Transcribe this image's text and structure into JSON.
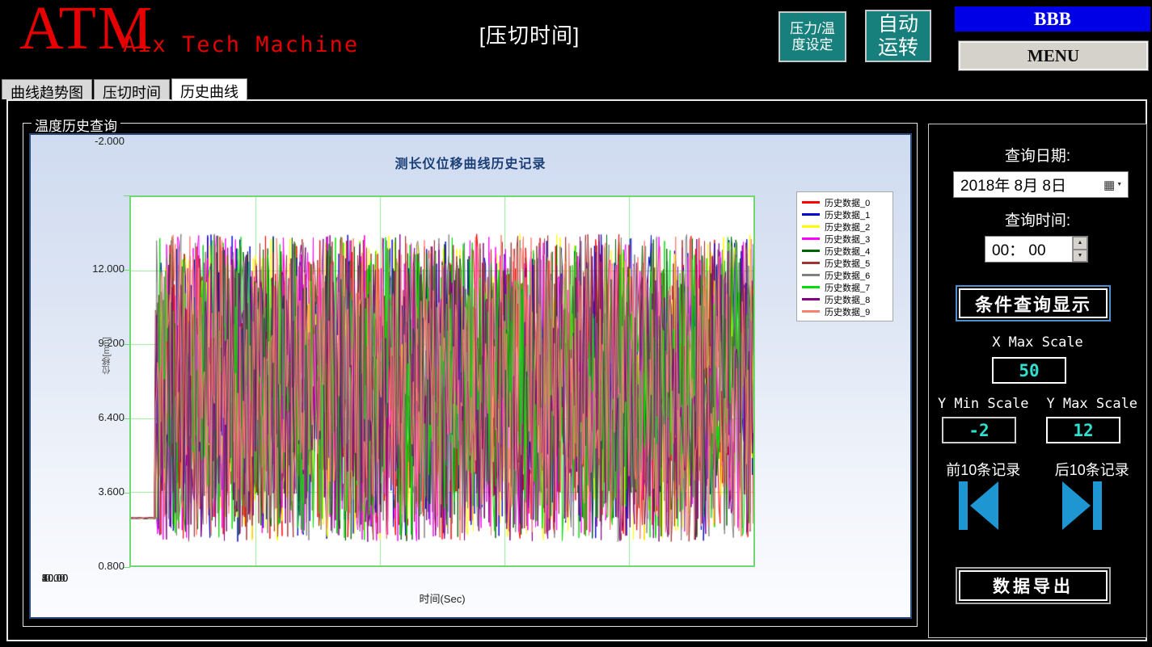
{
  "header": {
    "logo": "ATM",
    "logo_subtitle": "Aix Tech Machine",
    "page_title": "[压切时间]",
    "btn_pressure_temp_line1": "压力/温",
    "btn_pressure_temp_line2": "度设定",
    "btn_auto_line1": "自动",
    "btn_auto_line2": "运转",
    "banner": "BBB",
    "menu": "MENU"
  },
  "tabs": [
    {
      "label": "曲线趋势图",
      "active": false
    },
    {
      "label": "压切时间",
      "active": false
    },
    {
      "label": "历史曲线",
      "active": true
    }
  ],
  "groupbox_title": "温度历史查询",
  "chart_data": {
    "type": "line",
    "title": "测长仪位移曲线历史记录",
    "xlabel": "时间(Sec)",
    "ylabel": "位移[mm]",
    "xlim": [
      0,
      50
    ],
    "ylim": [
      -2,
      12
    ],
    "x_ticks": [
      "0.00",
      "10.00",
      "20.00",
      "30.00",
      "40.00",
      "50.00"
    ],
    "y_ticks": [
      "12.000",
      "9.200",
      "6.400",
      "3.600",
      "0.800",
      "-2.000"
    ],
    "grid": true,
    "legend_position": "right-top",
    "plot_border_color": "#6fd86f",
    "grid_color": "#98e698",
    "series": [
      {
        "name": "历史数据_0",
        "color": "#ff0000"
      },
      {
        "name": "历史数据_1",
        "color": "#0000cc"
      },
      {
        "name": "历史数据_2",
        "color": "#ffff00"
      },
      {
        "name": "历史数据_3",
        "color": "#ff00ff"
      },
      {
        "name": "历史数据_4",
        "color": "#006400"
      },
      {
        "name": "历史数据_5",
        "color": "#a03434"
      },
      {
        "name": "历史数据_6",
        "color": "#808080"
      },
      {
        "name": "历史数据_7",
        "color": "#00dd00"
      },
      {
        "name": "历史数据_8",
        "color": "#800080"
      },
      {
        "name": "历史数据_9",
        "color": "#fa8072"
      }
    ],
    "signal_model": {
      "description": "Each of the 10 series is flat at ~-0.2 mm from 0 s to ~2 s, then dense random noise between ~-1.1 mm and ~10.6 mm up to 50 s",
      "flat_until_sec": 2,
      "flat_value": -0.2,
      "noise_min": -1.1,
      "noise_max": 10.6,
      "points_per_series": 560
    }
  },
  "sidebar": {
    "query_date_label": "查询日期:",
    "query_date_value": "2018年 8月 8日",
    "query_time_label": "查询时间:",
    "query_time_value": "00： 00",
    "query_button": "条件查询显示",
    "x_max_label": "X Max Scale",
    "x_max_value": "50",
    "y_min_label": "Y Min Scale",
    "y_min_value": "-2",
    "y_max_label": "Y Max Scale",
    "y_max_value": "12",
    "prev_label": "前10条记录",
    "next_label": "后10条记录",
    "export_button": "数据导出"
  },
  "colors": {
    "brand_red": "#e60000",
    "banner_blue": "#0000e6",
    "button_teal": "#17807d",
    "value_cyan": "#2fe0cf",
    "icon_blue": "#1e96d2",
    "chart_title_navy": "#1c3f77"
  }
}
